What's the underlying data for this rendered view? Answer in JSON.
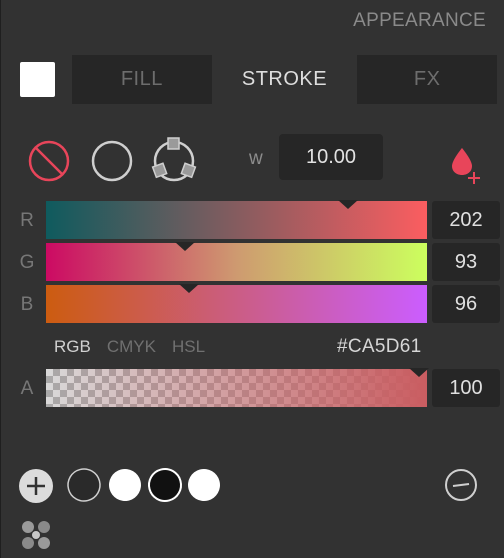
{
  "panel": {
    "title": "APPEARANCE"
  },
  "tabs": [
    {
      "label": "FILL",
      "active": false
    },
    {
      "label": "STROKE",
      "active": true
    },
    {
      "label": "FX",
      "active": false
    }
  ],
  "stroke": {
    "width_label": "w",
    "width_value": "10.00",
    "tools": [
      "no-stroke-icon",
      "ellipse-stroke-icon",
      "edit-path-stroke-icon"
    ]
  },
  "channels": [
    {
      "label": "R",
      "value": "202",
      "fraction": 0.792
    },
    {
      "label": "G",
      "value": "93",
      "fraction": 0.365
    },
    {
      "label": "B",
      "value": "96",
      "fraction": 0.376
    }
  ],
  "color_modes": [
    {
      "label": "RGB",
      "active": true
    },
    {
      "label": "CMYK",
      "active": false
    },
    {
      "label": "HSL",
      "active": false
    }
  ],
  "hex": "#CA5D61",
  "alpha": {
    "label": "A",
    "value": "100",
    "fraction": 1.0
  },
  "colors": {
    "current": "#CA5D61",
    "accent": "#E8455A",
    "panel_bg": "#323232"
  },
  "swatches": [
    {
      "color": "#2a2a2a"
    },
    {
      "color": "#ffffff"
    },
    {
      "color": "#111111"
    },
    {
      "color": "#ffffff"
    }
  ]
}
